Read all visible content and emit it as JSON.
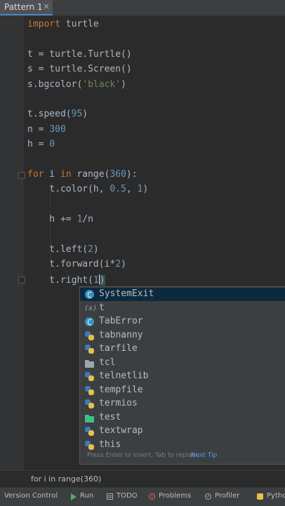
{
  "tab": {
    "title": "Pattern 1",
    "close": "×"
  },
  "code_lines": [
    {
      "parts": [
        {
          "t": "import",
          "c": "kw"
        },
        {
          "t": " turtle",
          "c": ""
        }
      ]
    },
    {
      "parts": []
    },
    {
      "parts": [
        {
          "t": "t = turtle.Turtle()",
          "c": ""
        }
      ]
    },
    {
      "parts": [
        {
          "t": "s = turtle.Screen()",
          "c": ""
        }
      ]
    },
    {
      "parts": [
        {
          "t": "s.bgcolor(",
          "c": ""
        },
        {
          "t": "'black'",
          "c": "str"
        },
        {
          "t": ")",
          "c": ""
        }
      ]
    },
    {
      "parts": []
    },
    {
      "parts": [
        {
          "t": "t.speed(",
          "c": ""
        },
        {
          "t": "95",
          "c": "num"
        },
        {
          "t": ")",
          "c": ""
        }
      ]
    },
    {
      "parts": [
        {
          "t": "n = ",
          "c": ""
        },
        {
          "t": "300",
          "c": "num"
        }
      ]
    },
    {
      "parts": [
        {
          "t": "h = ",
          "c": ""
        },
        {
          "t": "0",
          "c": "num"
        }
      ]
    },
    {
      "parts": []
    },
    {
      "parts": [
        {
          "t": "for",
          "c": "kw"
        },
        {
          "t": " i ",
          "c": ""
        },
        {
          "t": "in",
          "c": "kw"
        },
        {
          "t": " range(",
          "c": ""
        },
        {
          "t": "360",
          "c": "num"
        },
        {
          "t": "):",
          "c": ""
        }
      ]
    },
    {
      "parts": [
        {
          "t": "    t.color(h, ",
          "c": ""
        },
        {
          "t": "0.5",
          "c": "num"
        },
        {
          "t": ", ",
          "c": ""
        },
        {
          "t": "1",
          "c": "num"
        },
        {
          "t": ")",
          "c": ""
        }
      ]
    },
    {
      "parts": []
    },
    {
      "parts": [
        {
          "t": "    h += ",
          "c": ""
        },
        {
          "t": "1",
          "c": "num"
        },
        {
          "t": "/n",
          "c": ""
        }
      ]
    },
    {
      "parts": []
    },
    {
      "parts": [
        {
          "t": "    t.left(",
          "c": ""
        },
        {
          "t": "2",
          "c": "num"
        },
        {
          "t": ")",
          "c": ""
        }
      ]
    },
    {
      "parts": [
        {
          "t": "    t.forward(i*",
          "c": ""
        },
        {
          "t": "2",
          "c": "num"
        },
        {
          "t": ")",
          "c": ""
        }
      ]
    },
    {
      "parts": [
        {
          "t": "    t.right(",
          "c": ""
        },
        {
          "t": "1",
          "c": "num"
        },
        {
          "t": ")",
          "c": "paren"
        }
      ]
    }
  ],
  "completion": {
    "items": [
      {
        "label": "SystemExit",
        "icon": "class-icon",
        "selected": true
      },
      {
        "label": "t",
        "icon": "variable-icon",
        "selected": false
      },
      {
        "label": "TabError",
        "icon": "class-icon",
        "selected": false
      },
      {
        "label": "tabnanny",
        "icon": "python-module-icon",
        "selected": false
      },
      {
        "label": "tarfile",
        "icon": "python-module-icon",
        "selected": false
      },
      {
        "label": "tcl",
        "icon": "folder-icon",
        "selected": false
      },
      {
        "label": "telnetlib",
        "icon": "python-module-icon",
        "selected": false
      },
      {
        "label": "tempfile",
        "icon": "python-module-icon",
        "selected": false
      },
      {
        "label": "termios",
        "icon": "python-module-icon",
        "selected": false
      },
      {
        "label": "test",
        "icon": "package-folder-icon",
        "selected": false
      },
      {
        "label": "textwrap",
        "icon": "python-module-icon",
        "selected": false
      },
      {
        "label": "this",
        "icon": "python-module-icon",
        "selected": false
      }
    ],
    "hint": "Press Enter to insert, Tab to replace",
    "next_tip": "Next Tip",
    "variable_glyph": "(x)"
  },
  "breadcrumb": "for i in range(360)",
  "toolwindows": [
    {
      "label": "Version Control",
      "icon": ""
    },
    {
      "label": "Run",
      "icon": "run-icon"
    },
    {
      "label": "TODO",
      "icon": "todo-icon"
    },
    {
      "label": "Problems",
      "icon": "problems-icon"
    },
    {
      "label": "Profiler",
      "icon": "profiler-icon"
    },
    {
      "label": "Pytho",
      "icon": "python-console-icon"
    }
  ],
  "colors": {
    "editor_bg": "#2b2b2b",
    "keyword": "#cc7832",
    "number": "#6897bb",
    "string": "#6a8759",
    "selection": "#0d293e",
    "link": "#589df6"
  }
}
